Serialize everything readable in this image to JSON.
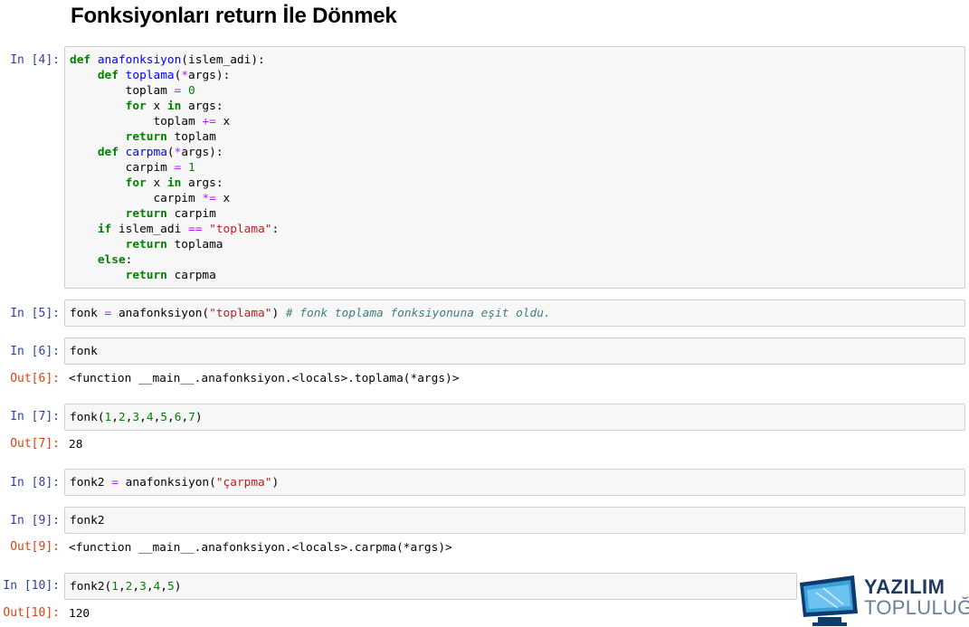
{
  "title": "Fonksiyonları return İle Dönmek",
  "cells": [
    {
      "prompt": "In [4]:",
      "type": "in"
    },
    {
      "prompt": "In [5]:",
      "type": "in"
    },
    {
      "prompt": "In [6]:",
      "type": "in",
      "code": "fonk"
    },
    {
      "prompt": "Out[6]:",
      "type": "out",
      "text": "<function __main__.anafonksiyon.<locals>.toplama(*args)>"
    },
    {
      "prompt": "In [7]:",
      "type": "in"
    },
    {
      "prompt": "Out[7]:",
      "type": "out",
      "text": "28"
    },
    {
      "prompt": "In [8]:",
      "type": "in"
    },
    {
      "prompt": "In [9]:",
      "type": "in",
      "code": "fonk2"
    },
    {
      "prompt": "Out[9]:",
      "type": "out",
      "text": "<function __main__.anafonksiyon.<locals>.carpma(*args)>"
    },
    {
      "prompt": "In [10]:",
      "type": "in"
    },
    {
      "prompt": "Out[10]:",
      "type": "out",
      "text": "120"
    }
  ],
  "code4": [
    "def anafonksiyon(islem_adi):",
    "    def toplama(*args):",
    "        toplam = 0",
    "        for x in args:",
    "            toplam += x",
    "        return toplam",
    "    def carpma(*args):",
    "        carpim = 1",
    "        for x in args:",
    "            carpim *= x",
    "        return carpim",
    "    if islem_adi == \"toplama\":",
    "        return toplama",
    "    else:",
    "        return carpma"
  ],
  "code5": "fonk = anafonksiyon(\"toplama\") # fonk toplama fonksiyonuna eşit oldu.",
  "code7": "fonk(1,2,3,4,5,6,7)",
  "code8": "fonk2 = anafonksiyon(\"çarpma\")",
  "code10": "fonk2(1,2,3,4,5)",
  "logo": {
    "line1": "YAZILIM",
    "line2": "TOPLULUĞU",
    "icon": "monitor-icon"
  },
  "colors": {
    "keyword": "#008000",
    "function": "#0000ff",
    "operator": "#aa22ff",
    "string": "#ba2121",
    "comment": "#408080",
    "in_prompt": "#303f9f",
    "out_prompt": "#d84315"
  }
}
